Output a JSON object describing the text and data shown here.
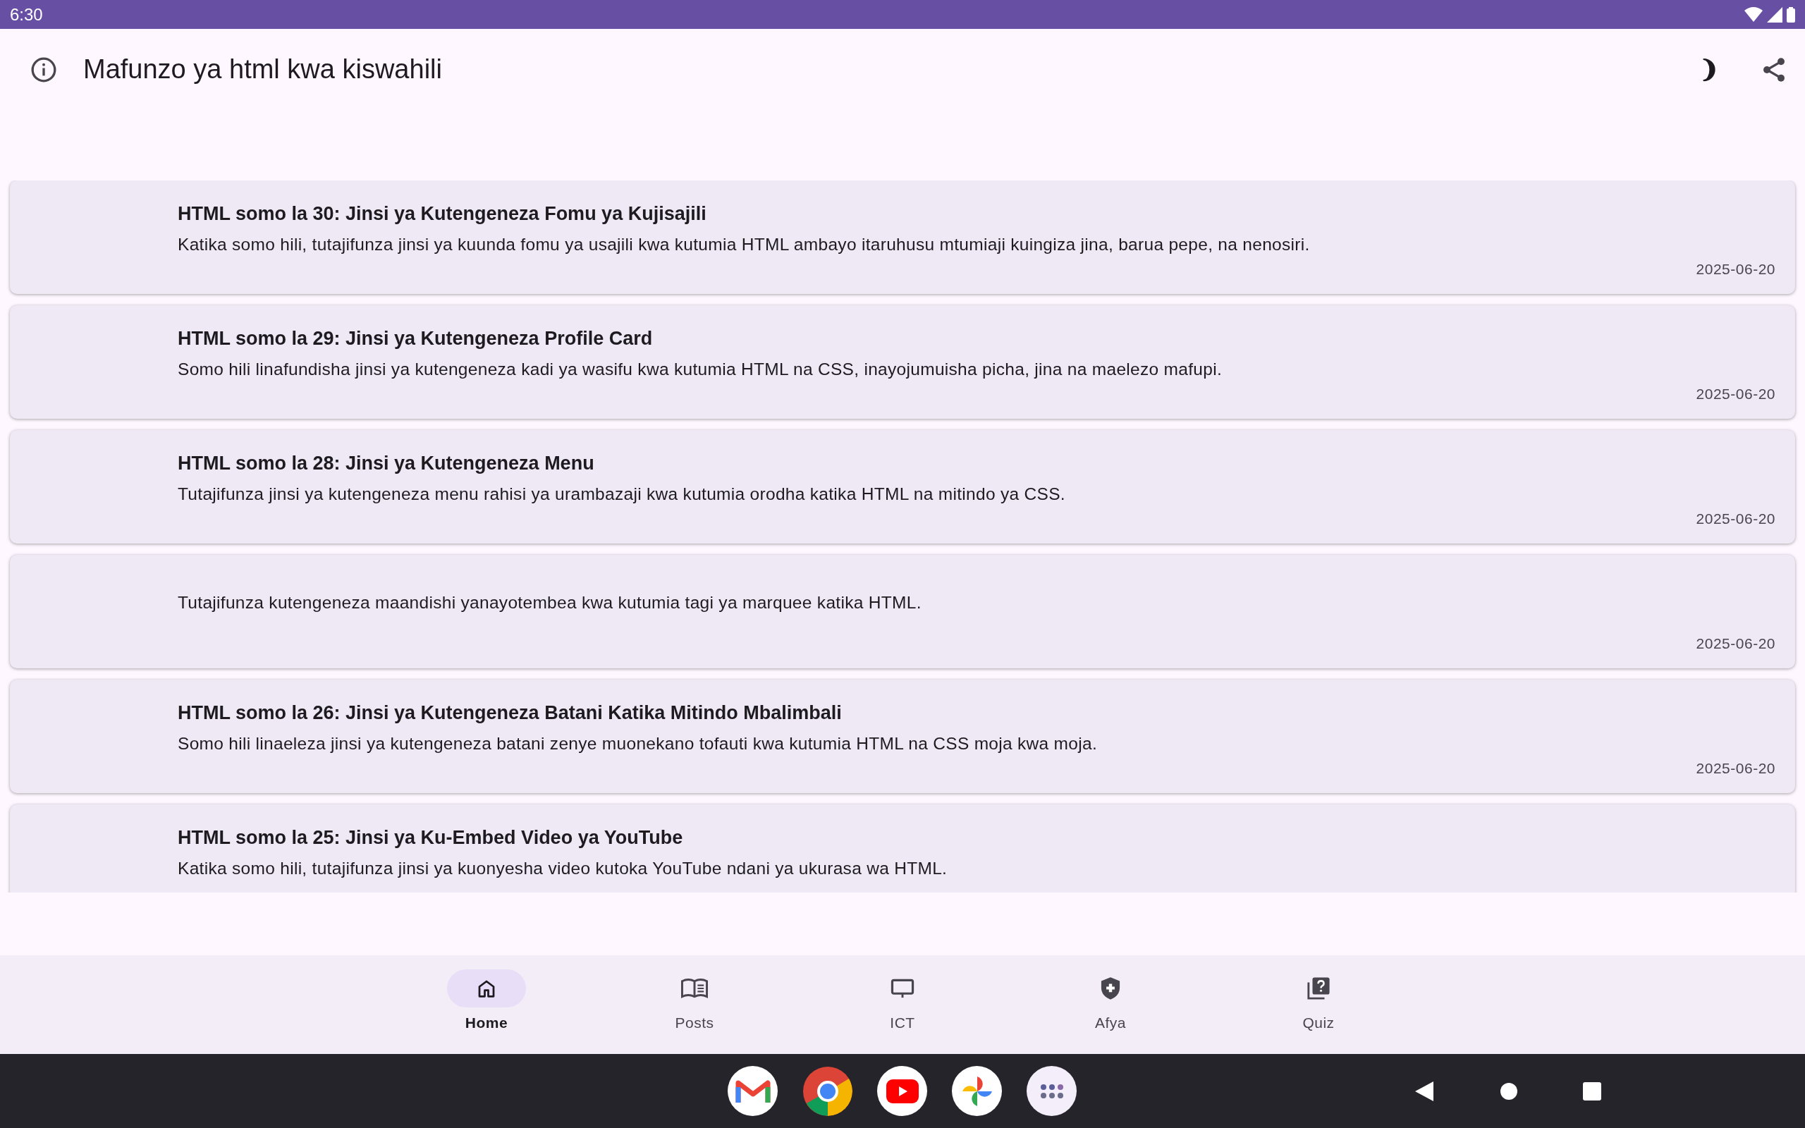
{
  "status_bar": {
    "time": "6:30"
  },
  "app_bar": {
    "title": "Mafunzo ya html kwa kiswahili"
  },
  "posts": [
    {
      "title": "HTML somo la 30: Jinsi ya Kutengeneza Fomu ya Kujisajili",
      "description": "Katika somo hili, tutajifunza jinsi ya kuunda fomu ya usajili kwa kutumia HTML ambayo itaruhusu mtumiaji kuingiza jina, barua pepe, na nenosiri.",
      "date": "2025-06-20"
    },
    {
      "title": "HTML somo la 29: Jinsi ya Kutengeneza Profile Card",
      "description": "Somo hili linafundisha jinsi ya kutengeneza kadi ya wasifu kwa kutumia HTML na CSS, inayojumuisha picha, jina na maelezo mafupi.",
      "date": "2025-06-20"
    },
    {
      "title": "HTML somo la 28: Jinsi ya Kutengeneza Menu",
      "description": "Tutajifunza jinsi ya kutengeneza menu rahisi ya urambazaji kwa kutumia orodha katika HTML na mitindo ya CSS.",
      "date": "2025-06-20"
    },
    {
      "description": "Tutajifunza kutengeneza maandishi yanayotembea kwa kutumia tagi ya marquee katika HTML.",
      "date": "2025-06-20"
    },
    {
      "title": "HTML somo la 26: Jinsi ya Kutengeneza Batani Katika Mitindo Mbalimbali",
      "description": "Somo hili linaeleza jinsi ya kutengeneza batani zenye muonekano tofauti kwa kutumia HTML na CSS moja kwa moja.",
      "date": "2025-06-20"
    },
    {
      "title": "HTML somo la 25: Jinsi ya Ku-Embed Video ya YouTube",
      "description": "Katika somo hili, tutajifunza jinsi ya kuonyesha video kutoka YouTube ndani ya ukurasa wa HTML."
    }
  ],
  "bottom_nav": [
    {
      "kind": "home",
      "label": "Home",
      "selected": true
    },
    {
      "kind": "posts",
      "label": "Posts",
      "selected": false
    },
    {
      "kind": "ict",
      "label": "ICT",
      "selected": false
    },
    {
      "kind": "afya",
      "label": "Afya",
      "selected": false
    },
    {
      "kind": "quiz",
      "label": "Quiz",
      "selected": false
    }
  ]
}
